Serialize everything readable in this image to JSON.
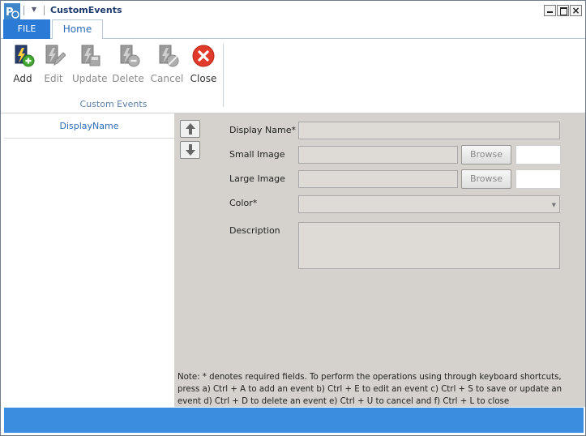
{
  "window": {
    "title": "CustomEvents"
  },
  "ribbon": {
    "tabs": [
      {
        "label": "FILE",
        "active": false
      },
      {
        "label": "Home",
        "active": true
      }
    ],
    "buttons": [
      {
        "id": "add",
        "label": "Add",
        "enabled": true
      },
      {
        "id": "edit",
        "label": "Edit",
        "enabled": false
      },
      {
        "id": "update",
        "label": "Update",
        "enabled": false
      },
      {
        "id": "delete",
        "label": "Delete",
        "enabled": false
      },
      {
        "id": "cancel",
        "label": "Cancel",
        "enabled": false
      },
      {
        "id": "close",
        "label": "Close",
        "enabled": true
      }
    ],
    "group_label": "Custom Events"
  },
  "list": {
    "column_header": "DisplayName",
    "rows": []
  },
  "form": {
    "display_name": {
      "label": "Display Name*",
      "value": ""
    },
    "small_image": {
      "label": "Small Image",
      "value": "",
      "browse_label": "Browse"
    },
    "large_image": {
      "label": "Large Image",
      "value": "",
      "browse_label": "Browse"
    },
    "color": {
      "label": "Color*",
      "value": ""
    },
    "description": {
      "label": "Description",
      "value": ""
    }
  },
  "note": "Note: * denotes required fields. To perform the operations using through keyboard shortcuts, press  a) Ctrl + A to add an event b) Ctrl +  E to edit an event c) Ctrl + S to save or update an event d) Ctrl + D to delete an event e) Ctrl + U to cancel and f) Ctrl + L to close",
  "colors": {
    "accent": "#2b7bd6",
    "status_bar": "#3b8de0",
    "form_bg": "#d5d2cd",
    "close_red": "#e03a2a"
  }
}
